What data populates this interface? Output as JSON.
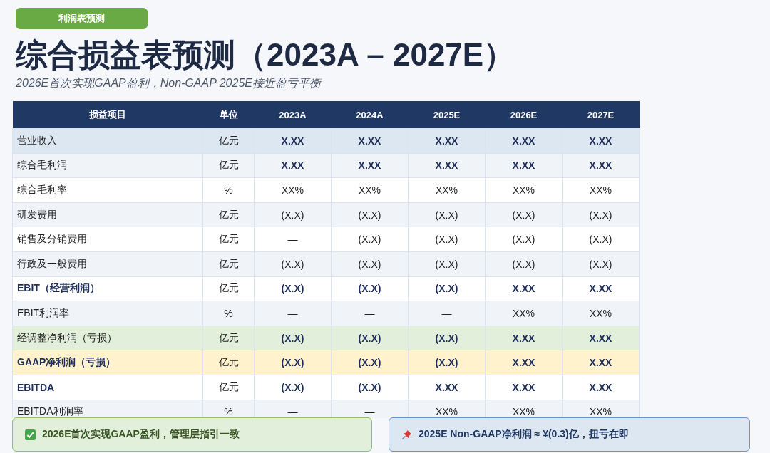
{
  "badge": "利润表预测",
  "title": "综合损益表预测（2023A – 2027E）",
  "subtitle": "2026E首次实现GAAP盈利，Non-GAAP 2025E接近盈亏平衡",
  "table": {
    "columns": [
      "损益项目",
      "单位",
      "2023A",
      "2024A",
      "2025E",
      "2026E",
      "2027E"
    ],
    "rows": [
      {
        "name": "营业收入",
        "unit": "亿元",
        "values": [
          "X.XX",
          "X.XX",
          "X.XX",
          "X.XX",
          "X.XX"
        ],
        "kind": "revenue",
        "name_bold": false,
        "values_bold": true
      },
      {
        "name": "综合毛利润",
        "unit": "亿元",
        "values": [
          "X.XX",
          "X.XX",
          "X.XX",
          "X.XX",
          "X.XX"
        ],
        "kind": "normal",
        "name_bold": false,
        "values_bold": true
      },
      {
        "name": "综合毛利率",
        "unit": "%",
        "values": [
          "XX%",
          "XX%",
          "XX%",
          "XX%",
          "XX%"
        ],
        "kind": "normal",
        "name_bold": false,
        "values_bold": false
      },
      {
        "name": "研发费用",
        "unit": "亿元",
        "values": [
          "(X.X)",
          "(X.X)",
          "(X.X)",
          "(X.X)",
          "(X.X)"
        ],
        "kind": "normal",
        "name_bold": false,
        "values_bold": false
      },
      {
        "name": "销售及分销费用",
        "unit": "亿元",
        "values": [
          "—",
          "(X.X)",
          "(X.X)",
          "(X.X)",
          "(X.X)"
        ],
        "kind": "normal",
        "name_bold": false,
        "values_bold": false
      },
      {
        "name": "行政及一般费用",
        "unit": "亿元",
        "values": [
          "(X.X)",
          "(X.X)",
          "(X.X)",
          "(X.X)",
          "(X.X)"
        ],
        "kind": "normal",
        "name_bold": false,
        "values_bold": false
      },
      {
        "name": "EBIT（经营利润）",
        "unit": "亿元",
        "values": [
          "(X.X)",
          "(X.X)",
          "(X.X)",
          "X.XX",
          "X.XX"
        ],
        "kind": "normal",
        "name_bold": true,
        "values_bold": true
      },
      {
        "name": "EBIT利润率",
        "unit": "%",
        "values": [
          "—",
          "—",
          "—",
          "XX%",
          "XX%"
        ],
        "kind": "normal",
        "name_bold": false,
        "values_bold": false
      },
      {
        "name": "经调整净利润（亏损）",
        "unit": "亿元",
        "values": [
          "(X.X)",
          "(X.X)",
          "(X.X)",
          "X.XX",
          "X.XX"
        ],
        "kind": "adjusted",
        "name_bold": false,
        "values_bold": true
      },
      {
        "name": "GAAP净利润（亏损）",
        "unit": "亿元",
        "values": [
          "(X.X)",
          "(X.X)",
          "(X.X)",
          "X.XX",
          "X.XX"
        ],
        "kind": "gaap",
        "name_bold": true,
        "values_bold": true
      },
      {
        "name": "EBITDA",
        "unit": "亿元",
        "values": [
          "(X.X)",
          "(X.X)",
          "X.XX",
          "X.XX",
          "X.XX"
        ],
        "kind": "normal",
        "name_bold": true,
        "values_bold": true
      },
      {
        "name": "EBITDA利润率",
        "unit": "%",
        "values": [
          "—",
          "—",
          "XX%",
          "XX%",
          "XX%"
        ],
        "kind": "normal",
        "name_bold": false,
        "values_bold": false
      }
    ]
  },
  "callouts": [
    {
      "kind": "check",
      "text": "2026E首次实现GAAP盈利，管理层指引一致"
    },
    {
      "kind": "pin",
      "text": "2025E Non-GAAP净利润 ≈ ¥(0.3)亿，扭亏在即"
    }
  ]
}
